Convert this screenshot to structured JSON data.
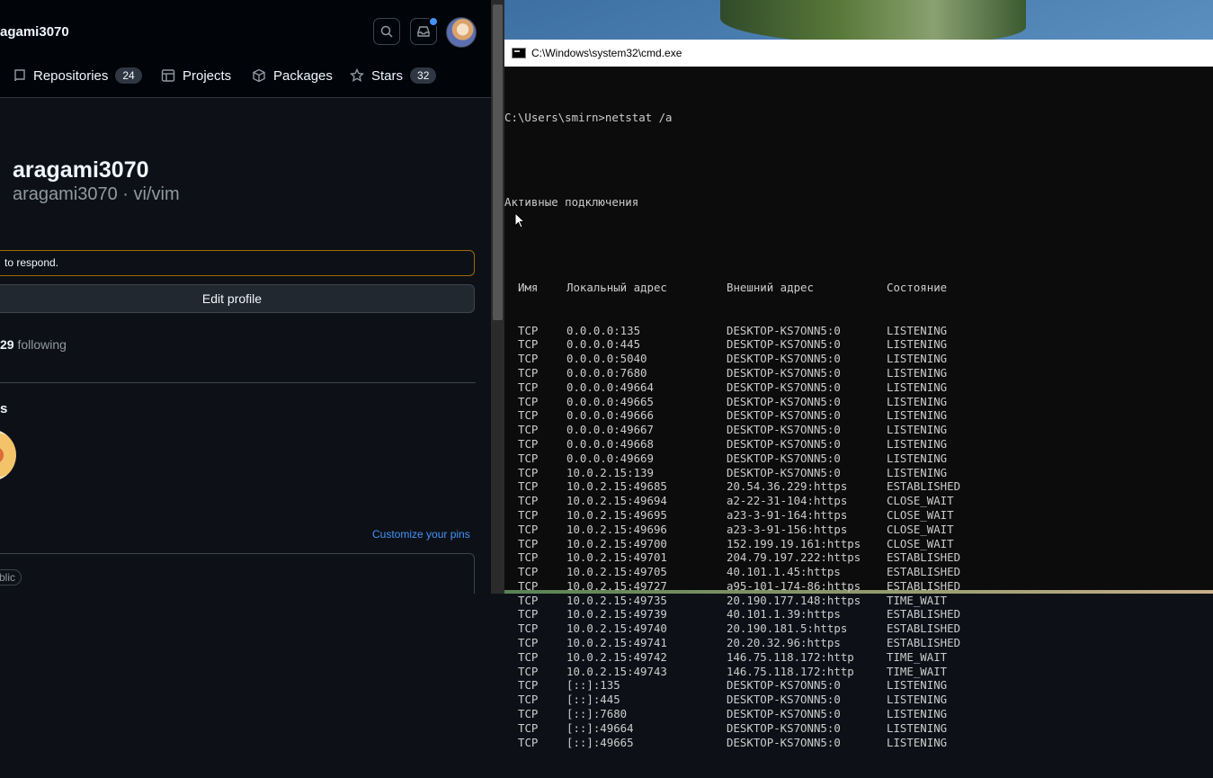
{
  "github": {
    "username_nav": "agami3070",
    "nav": {
      "repositories": {
        "label": "Repositories",
        "count": "24"
      },
      "projects": {
        "label": "Projects"
      },
      "packages": {
        "label": "Packages"
      },
      "stars": {
        "label": "Stars",
        "count": "32"
      }
    },
    "profile": {
      "name": "aragami3070",
      "subtitle": "aragami3070 · vi/vim",
      "status_text": "to respond.",
      "edit_profile": "Edit profile",
      "following_count": "29",
      "following_label": "following",
      "achievements_title": "s",
      "customize_pins": "Customize your pins",
      "pin_visibility": "blic"
    }
  },
  "cmd": {
    "title": "C:\\Windows\\system32\\cmd.exe",
    "prompt": "C:\\Users\\smirn>netstat /a",
    "section": "Активные подключения",
    "headers": {
      "proto": "Имя",
      "local": "Локальный адрес",
      "foreign": "Внешний адрес",
      "state": "Состояние"
    },
    "rows": [
      [
        "TCP",
        "0.0.0.0:135",
        "DESKTOP-KS7ONN5:0",
        "LISTENING"
      ],
      [
        "TCP",
        "0.0.0.0:445",
        "DESKTOP-KS7ONN5:0",
        "LISTENING"
      ],
      [
        "TCP",
        "0.0.0.0:5040",
        "DESKTOP-KS7ONN5:0",
        "LISTENING"
      ],
      [
        "TCP",
        "0.0.0.0:7680",
        "DESKTOP-KS7ONN5:0",
        "LISTENING"
      ],
      [
        "TCP",
        "0.0.0.0:49664",
        "DESKTOP-KS7ONN5:0",
        "LISTENING"
      ],
      [
        "TCP",
        "0.0.0.0:49665",
        "DESKTOP-KS7ONN5:0",
        "LISTENING"
      ],
      [
        "TCP",
        "0.0.0.0:49666",
        "DESKTOP-KS7ONN5:0",
        "LISTENING"
      ],
      [
        "TCP",
        "0.0.0.0:49667",
        "DESKTOP-KS7ONN5:0",
        "LISTENING"
      ],
      [
        "TCP",
        "0.0.0.0:49668",
        "DESKTOP-KS7ONN5:0",
        "LISTENING"
      ],
      [
        "TCP",
        "0.0.0.0:49669",
        "DESKTOP-KS7ONN5:0",
        "LISTENING"
      ],
      [
        "TCP",
        "10.0.2.15:139",
        "DESKTOP-KS7ONN5:0",
        "LISTENING"
      ],
      [
        "TCP",
        "10.0.2.15:49685",
        "20.54.36.229:https",
        "ESTABLISHED"
      ],
      [
        "TCP",
        "10.0.2.15:49694",
        "a2-22-31-104:https",
        "CLOSE_WAIT"
      ],
      [
        "TCP",
        "10.0.2.15:49695",
        "a23-3-91-164:https",
        "CLOSE_WAIT"
      ],
      [
        "TCP",
        "10.0.2.15:49696",
        "a23-3-91-156:https",
        "CLOSE_WAIT"
      ],
      [
        "TCP",
        "10.0.2.15:49700",
        "152.199.19.161:https",
        "CLOSE_WAIT"
      ],
      [
        "TCP",
        "10.0.2.15:49701",
        "204.79.197.222:https",
        "ESTABLISHED"
      ],
      [
        "TCP",
        "10.0.2.15:49705",
        "40.101.1.45:https",
        "ESTABLISHED"
      ],
      [
        "TCP",
        "10.0.2.15:49727",
        "a95-101-174-86:https",
        "ESTABLISHED"
      ],
      [
        "TCP",
        "10.0.2.15:49735",
        "20.190.177.148:https",
        "TIME_WAIT"
      ],
      [
        "TCP",
        "10.0.2.15:49739",
        "40.101.1.39:https",
        "ESTABLISHED"
      ],
      [
        "TCP",
        "10.0.2.15:49740",
        "20.190.181.5:https",
        "ESTABLISHED"
      ],
      [
        "TCP",
        "10.0.2.15:49741",
        "20.20.32.96:https",
        "ESTABLISHED"
      ],
      [
        "TCP",
        "10.0.2.15:49742",
        "146.75.118.172:http",
        "TIME_WAIT"
      ],
      [
        "TCP",
        "10.0.2.15:49743",
        "146.75.118.172:http",
        "TIME_WAIT"
      ],
      [
        "TCP",
        "[::]:135",
        "DESKTOP-KS7ONN5:0",
        "LISTENING"
      ],
      [
        "TCP",
        "[::]:445",
        "DESKTOP-KS7ONN5:0",
        "LISTENING"
      ],
      [
        "TCP",
        "[::]:7680",
        "DESKTOP-KS7ONN5:0",
        "LISTENING"
      ],
      [
        "TCP",
        "[::]:49664",
        "DESKTOP-KS7ONN5:0",
        "LISTENING"
      ],
      [
        "TCP",
        "[::]:49665",
        "DESKTOP-KS7ONN5:0",
        "LISTENING"
      ]
    ]
  }
}
